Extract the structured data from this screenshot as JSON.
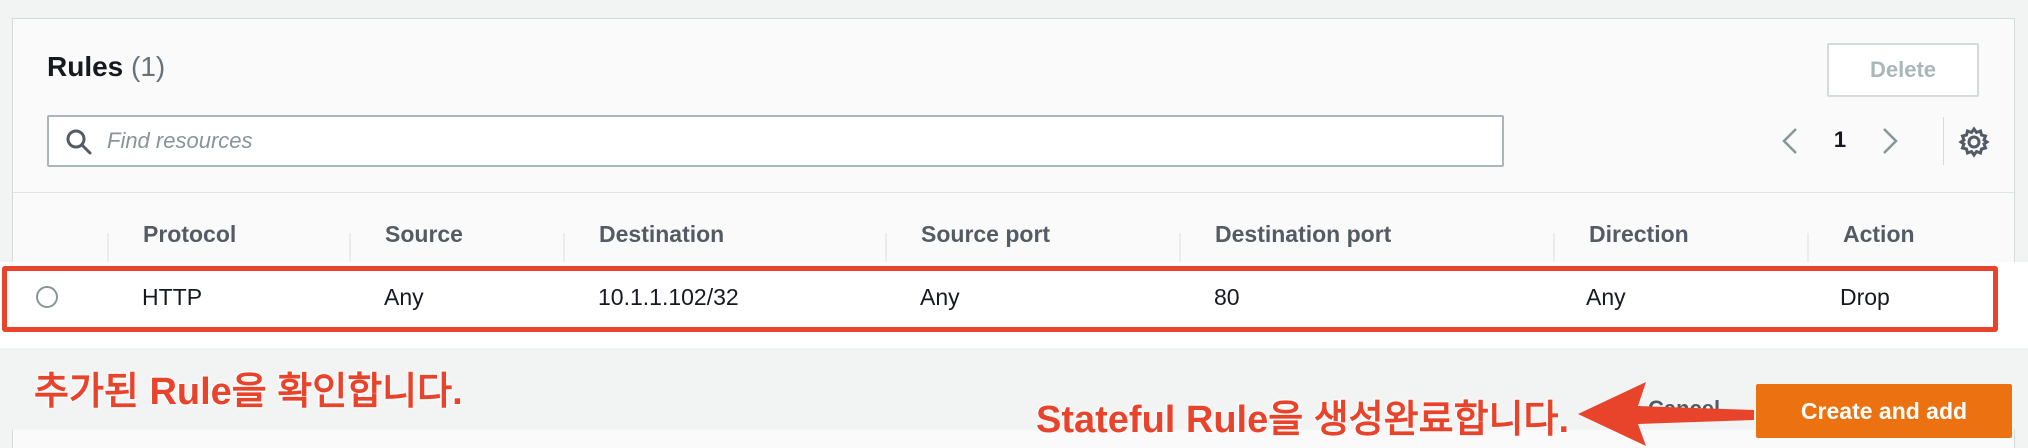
{
  "rules_panel": {
    "title": "Rules",
    "count": "(1)",
    "delete_label": "Delete",
    "search_placeholder": "Find resources",
    "page_number": "1"
  },
  "table": {
    "columns": [
      "Protocol",
      "Source",
      "Destination",
      "Source port",
      "Destination port",
      "Direction",
      "Action"
    ],
    "rows": [
      {
        "protocol": "HTTP",
        "source": "Any",
        "destination": "10.1.1.102/32",
        "source_port": "Any",
        "destination_port": "80",
        "direction": "Any",
        "action": "Drop"
      }
    ]
  },
  "footer": {
    "cancel_label": "Cancel",
    "create_label": "Create and add"
  },
  "annotations": {
    "row_note": "추가된 Rule을 확인합니다.",
    "create_note": "Stateful Rule을 생성완료합니다."
  },
  "colors": {
    "highlight": "#e8442c",
    "primary_button": "#ec7211"
  },
  "icons": {
    "search": "search-icon",
    "prev": "chevron-left-icon",
    "next": "chevron-right-icon",
    "settings": "gear-icon",
    "arrow": "arrow-left-icon"
  }
}
